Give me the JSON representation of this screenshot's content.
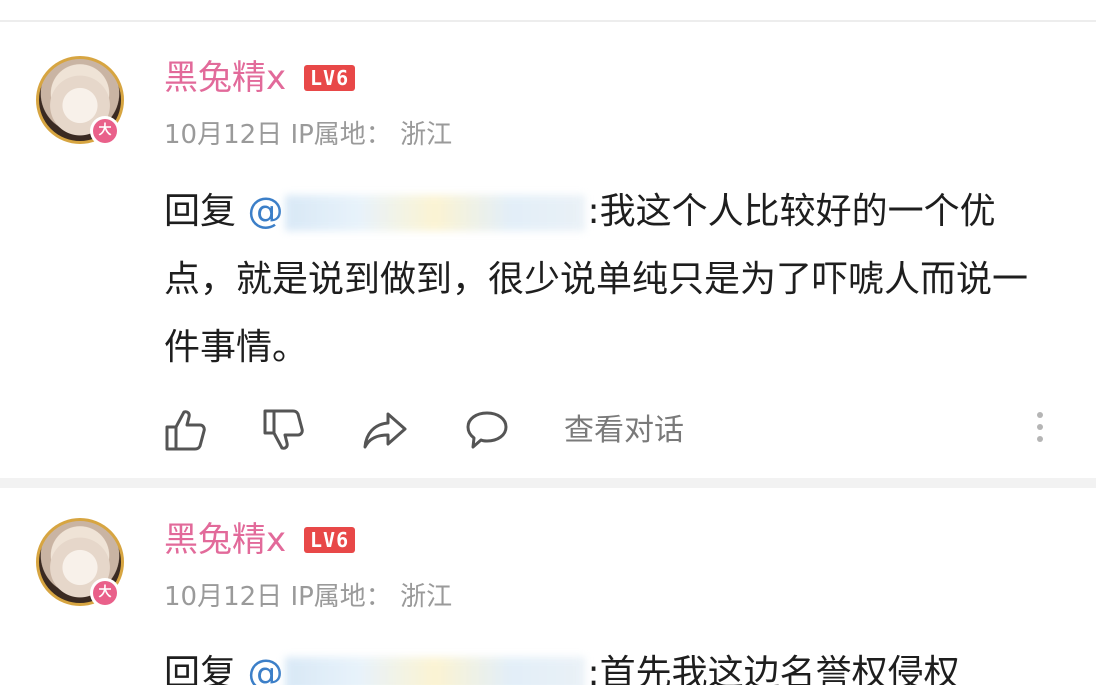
{
  "comments": [
    {
      "username": "黑兔精x",
      "level": "LV6",
      "badge": "大",
      "date": "10月12日",
      "ip_label": "IP属地：",
      "ip_location": "浙江",
      "reply_prefix": "回复",
      "mention": "@",
      "body": ":我这个人比较好的一个优点，就是说到做到，很少说单纯只是为了吓唬人而说一件事情。",
      "actions": {
        "view_conversation": "查看对话"
      }
    },
    {
      "username": "黑兔精x",
      "level": "LV6",
      "badge": "大",
      "date": "10月12日",
      "ip_label": "IP属地：",
      "ip_location": "浙江",
      "reply_prefix": "回复",
      "mention": "@",
      "body": ":首先我这边名誉权侵权"
    }
  ],
  "icons": [
    "like-icon",
    "dislike-icon",
    "share-icon",
    "comment-icon",
    "more-options-icon"
  ],
  "colors": {
    "username": "#e26a9a",
    "level_badge": "#e84848",
    "mention": "#3c7fc8",
    "meta": "#9a9a9a"
  }
}
